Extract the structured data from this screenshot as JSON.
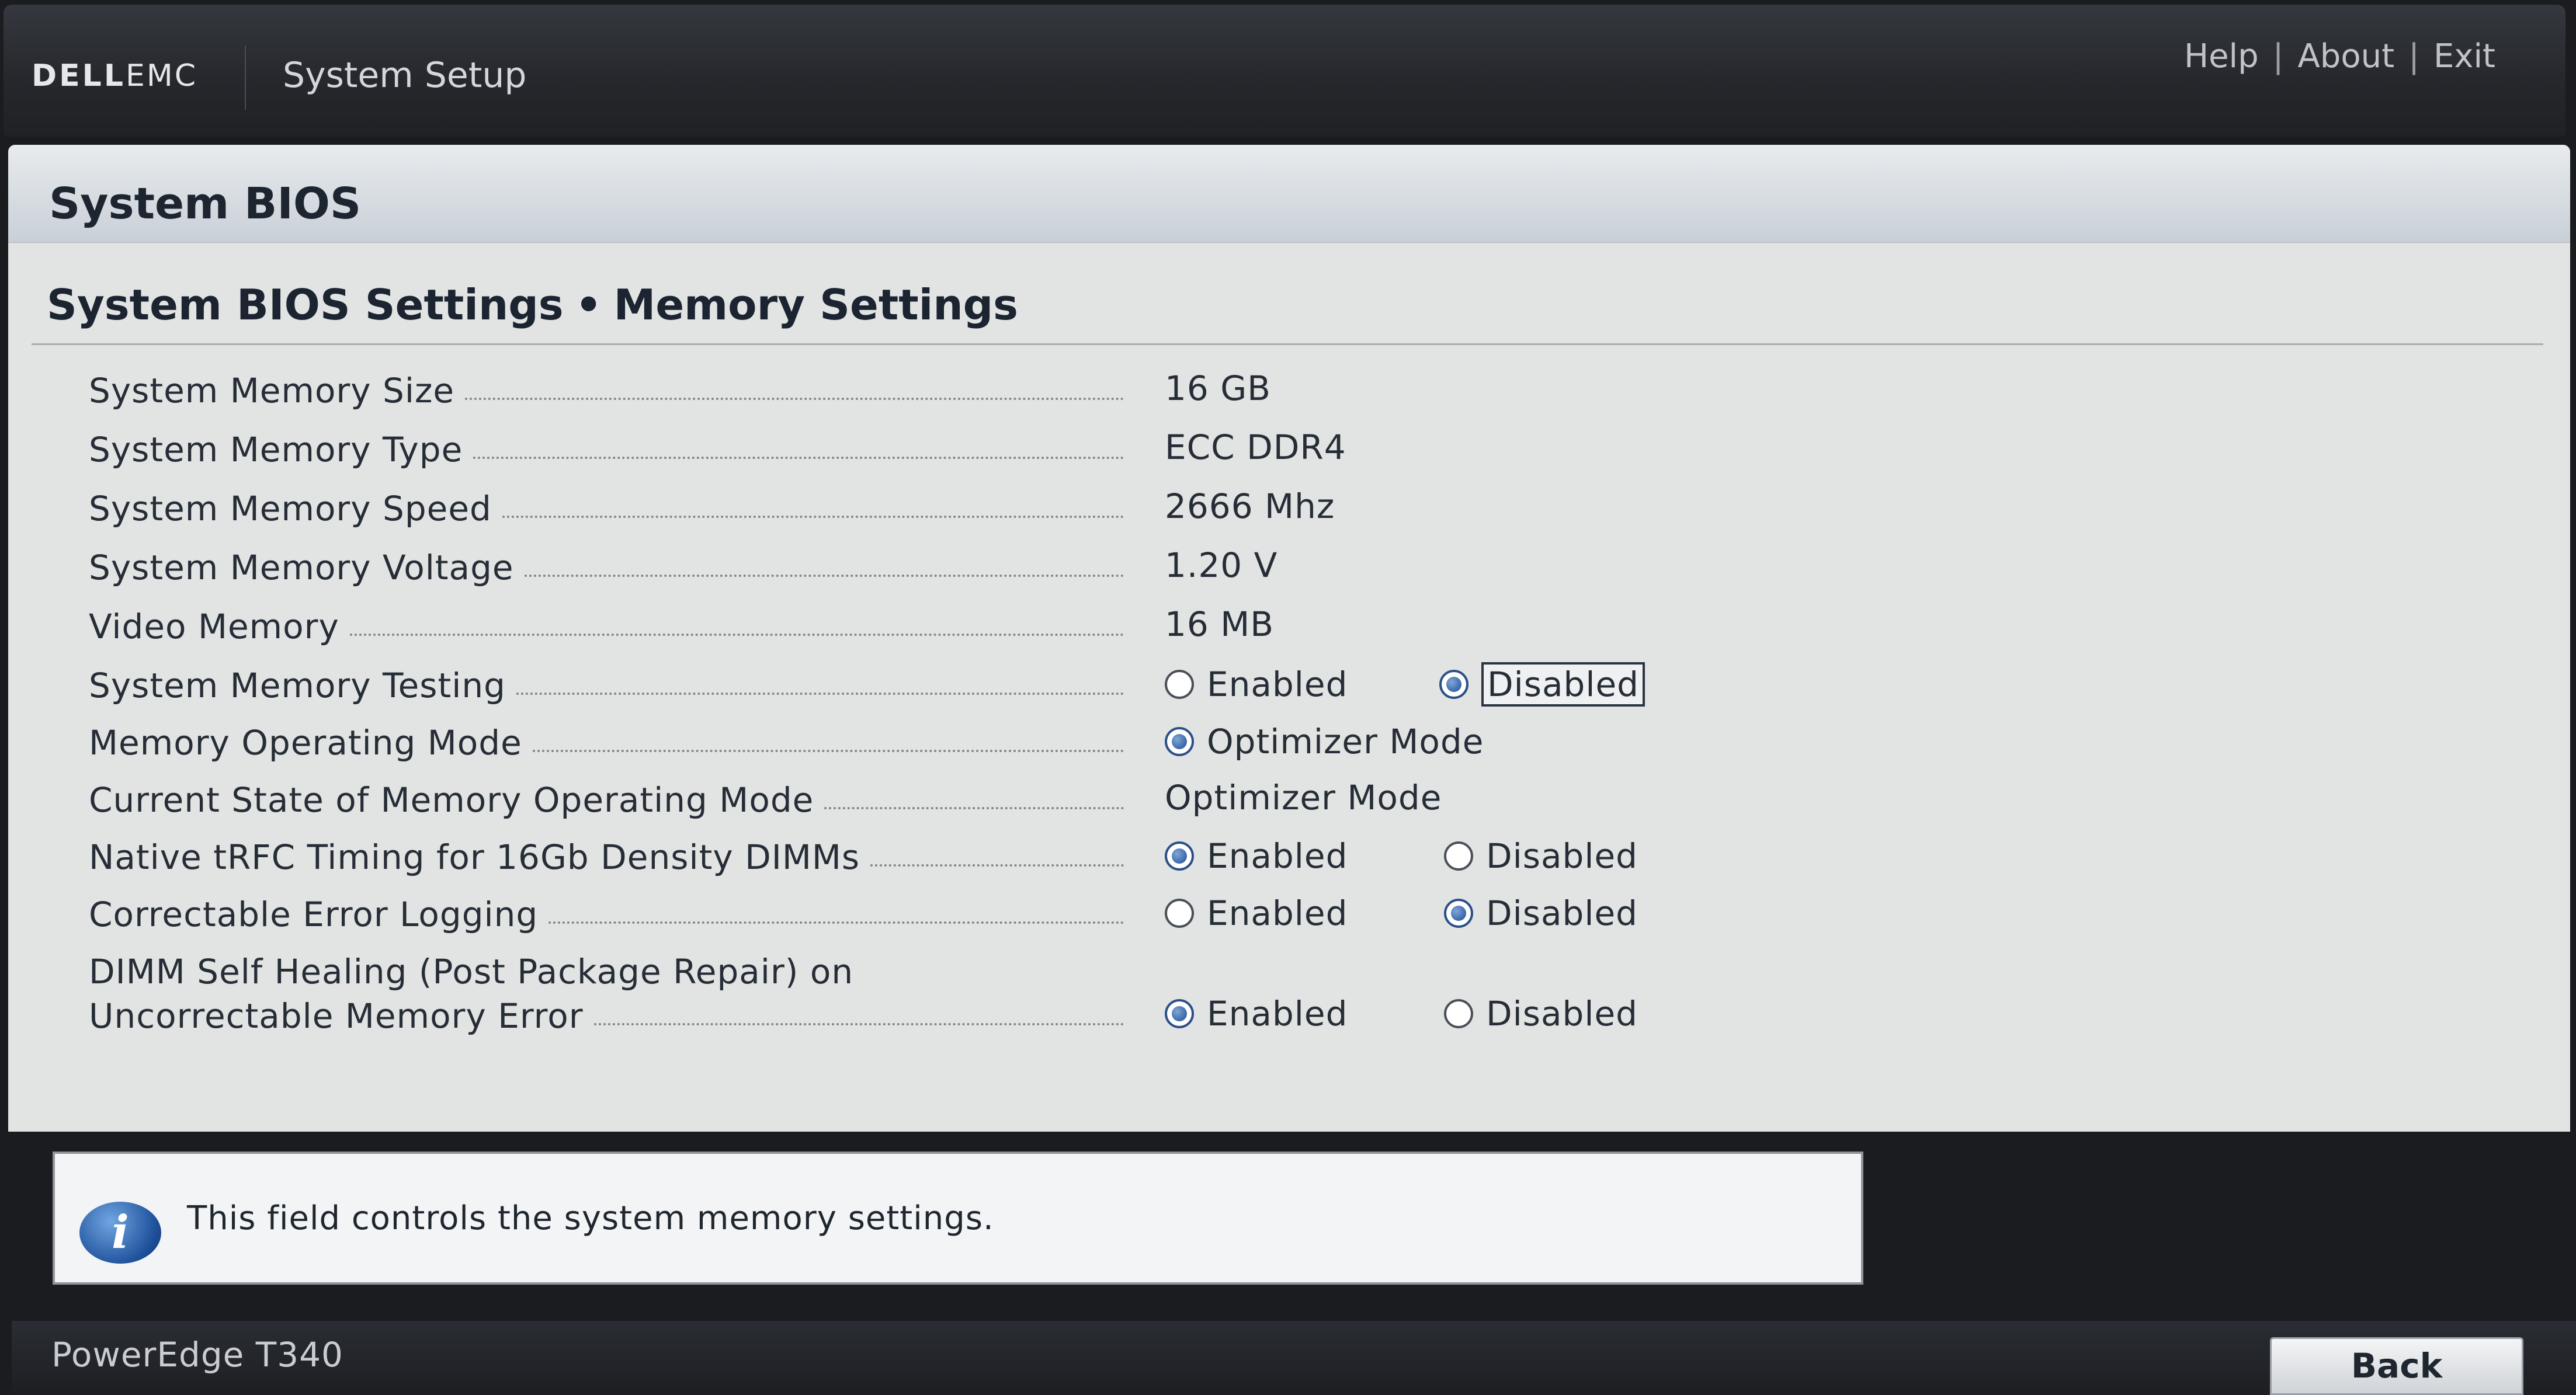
{
  "header": {
    "brand_dell": "DELL",
    "brand_emc": "EMC",
    "app_title": "System Setup",
    "links": [
      "Help",
      "About",
      "Exit"
    ],
    "separator": "|"
  },
  "page": {
    "title": "System BIOS",
    "breadcrumb": [
      "System BIOS Settings",
      "Memory Settings"
    ],
    "breadcrumb_separator": "•"
  },
  "settings": [
    {
      "label": "System Memory Size",
      "value": "16 GB"
    },
    {
      "label": "System Memory Type",
      "value": "ECC DDR4"
    },
    {
      "label": "System Memory Speed",
      "value": "2666 Mhz"
    },
    {
      "label": "System Memory Voltage",
      "value": "1.20 V"
    },
    {
      "label": "Video Memory",
      "value": "16 MB"
    },
    {
      "label": "System Memory Testing",
      "options": [
        "Enabled",
        "Disabled"
      ],
      "selected": "Disabled",
      "focused": "Disabled"
    },
    {
      "label": "Memory Operating Mode",
      "options": [
        "Optimizer Mode"
      ],
      "selected": "Optimizer Mode"
    },
    {
      "label": "Current State of Memory Operating Mode",
      "value": "Optimizer Mode"
    },
    {
      "label": "Native tRFC Timing for 16Gb Density DIMMs",
      "options": [
        "Enabled",
        "Disabled"
      ],
      "selected": "Enabled"
    },
    {
      "label": "Correctable Error Logging",
      "options": [
        "Enabled",
        "Disabled"
      ],
      "selected": "Disabled"
    },
    {
      "label_line1": "DIMM Self Healing (Post Package Repair) on",
      "label_line2": "Uncorrectable Memory Error",
      "options": [
        "Enabled",
        "Disabled"
      ],
      "selected": "Enabled"
    }
  ],
  "help": {
    "icon": "info-icon",
    "icon_glyph": "i",
    "text": "This field controls the system memory settings."
  },
  "footer": {
    "model": "PowerEdge T340",
    "back_label": "Back"
  },
  "colors": {
    "header_bg": "#26282d",
    "panel_bg": "#e2e4e3",
    "title_band": "#c9d0d7",
    "radio_selected": "#1f4d93",
    "footer_bg": "#1c1e22"
  }
}
